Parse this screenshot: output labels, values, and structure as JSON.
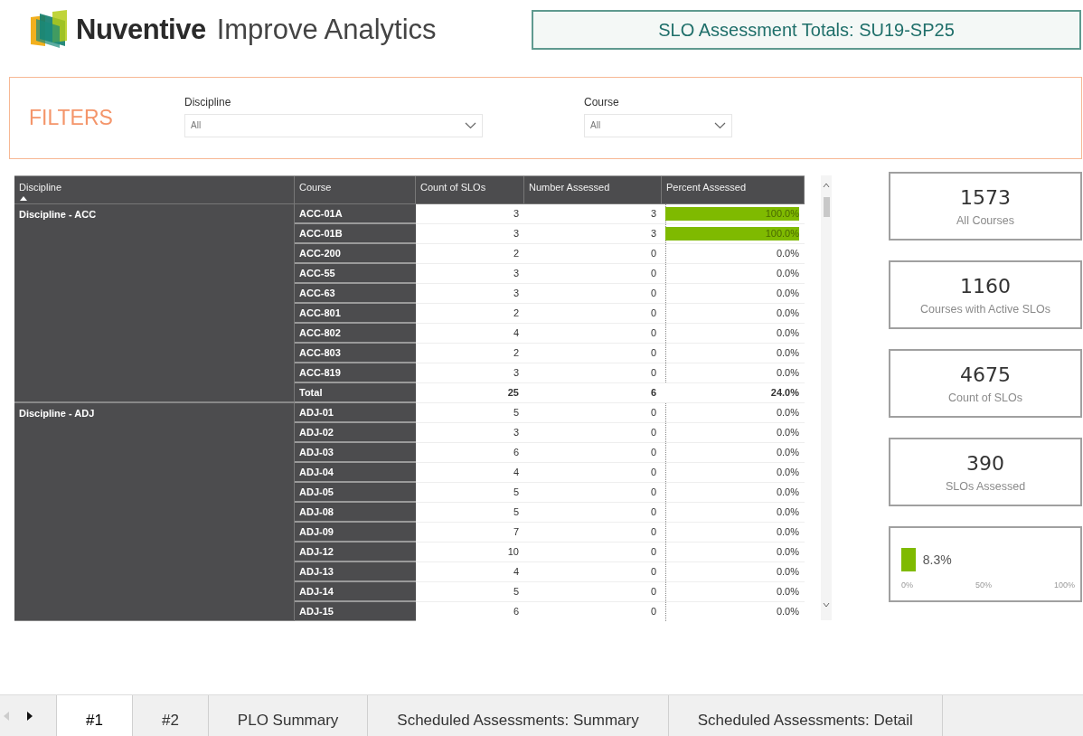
{
  "header": {
    "logo": {
      "brand": "Nuventive",
      "product": "Improve Analytics"
    },
    "title": "SLO Assessment Totals: SU19-SP25"
  },
  "filters": {
    "title": "FILTERS",
    "fields": [
      {
        "label": "Discipline",
        "value": "All"
      },
      {
        "label": "Course",
        "value": "All"
      }
    ]
  },
  "table": {
    "columns": [
      "Discipline",
      "Course",
      "Count of SLOs",
      "Number Assessed",
      "Percent Assessed"
    ],
    "groups": [
      {
        "discipline": "Discipline - ACC",
        "rows": [
          {
            "kind": "course",
            "course": "ACC-01A",
            "count": "3",
            "assessed": "3",
            "percent": "100.0%",
            "level": 1
          },
          {
            "kind": "course",
            "course": "ACC-01B",
            "count": "3",
            "assessed": "3",
            "percent": "100.0%",
            "level": 1
          },
          {
            "kind": "course",
            "course": "ACC-200",
            "count": "2",
            "assessed": "0",
            "percent": "0.0%"
          },
          {
            "kind": "course",
            "course": "ACC-55",
            "count": "3",
            "assessed": "0",
            "percent": "0.0%"
          },
          {
            "kind": "course",
            "course": "ACC-63",
            "count": "3",
            "assessed": "0",
            "percent": "0.0%"
          },
          {
            "kind": "course",
            "course": "ACC-801",
            "count": "2",
            "assessed": "0",
            "percent": "0.0%"
          },
          {
            "kind": "course",
            "course": "ACC-802",
            "count": "4",
            "assessed": "0",
            "percent": "0.0%"
          },
          {
            "kind": "course",
            "course": "ACC-803",
            "count": "2",
            "assessed": "0",
            "percent": "0.0%"
          },
          {
            "kind": "course",
            "course": "ACC-819",
            "count": "3",
            "assessed": "0",
            "percent": "0.0%"
          },
          {
            "kind": "total",
            "course": "Total",
            "count": "25",
            "assessed": "6",
            "percent": "24.0%"
          }
        ]
      },
      {
        "discipline": "Discipline - ADJ",
        "rows": [
          {
            "kind": "course",
            "course": "ADJ-01",
            "count": "5",
            "assessed": "0",
            "percent": "0.0%"
          },
          {
            "kind": "course",
            "course": "ADJ-02",
            "count": "3",
            "assessed": "0",
            "percent": "0.0%"
          },
          {
            "kind": "course",
            "course": "ADJ-03",
            "count": "6",
            "assessed": "0",
            "percent": "0.0%"
          },
          {
            "kind": "course",
            "course": "ADJ-04",
            "count": "4",
            "assessed": "0",
            "percent": "0.0%"
          },
          {
            "kind": "course",
            "course": "ADJ-05",
            "count": "5",
            "assessed": "0",
            "percent": "0.0%"
          },
          {
            "kind": "course",
            "course": "ADJ-08",
            "count": "5",
            "assessed": "0",
            "percent": "0.0%"
          },
          {
            "kind": "course",
            "course": "ADJ-09",
            "count": "7",
            "assessed": "0",
            "percent": "0.0%"
          },
          {
            "kind": "course",
            "course": "ADJ-12",
            "count": "10",
            "assessed": "0",
            "percent": "0.0%"
          },
          {
            "kind": "course",
            "course": "ADJ-13",
            "count": "4",
            "assessed": "0",
            "percent": "0.0%"
          },
          {
            "kind": "course",
            "course": "ADJ-14",
            "count": "5",
            "assessed": "0",
            "percent": "0.0%"
          },
          {
            "kind": "course",
            "course": "ADJ-15",
            "count": "6",
            "assessed": "0",
            "percent": "0.0%"
          }
        ]
      }
    ]
  },
  "cards": [
    {
      "value": "1573",
      "label": "All Courses"
    },
    {
      "value": "1160",
      "label": "Courses with Active SLOs"
    },
    {
      "value": "4675",
      "label": "Count of SLOs"
    },
    {
      "value": "390",
      "label": "SLOs Assessed"
    }
  ],
  "gauge": {
    "level": 0.083,
    "reading": "8.3%",
    "ticks": [
      "0%",
      "50%",
      "100%"
    ]
  },
  "tabs": [
    {
      "label": "#1",
      "selected": true
    },
    {
      "label": "#2",
      "selected": false
    },
    {
      "label": "PLO Summary",
      "selected": false
    },
    {
      "label": "Scheduled Assessments: Summary",
      "selected": false
    },
    {
      "label": "Scheduled Assessments: Detail",
      "selected": false
    }
  ]
}
